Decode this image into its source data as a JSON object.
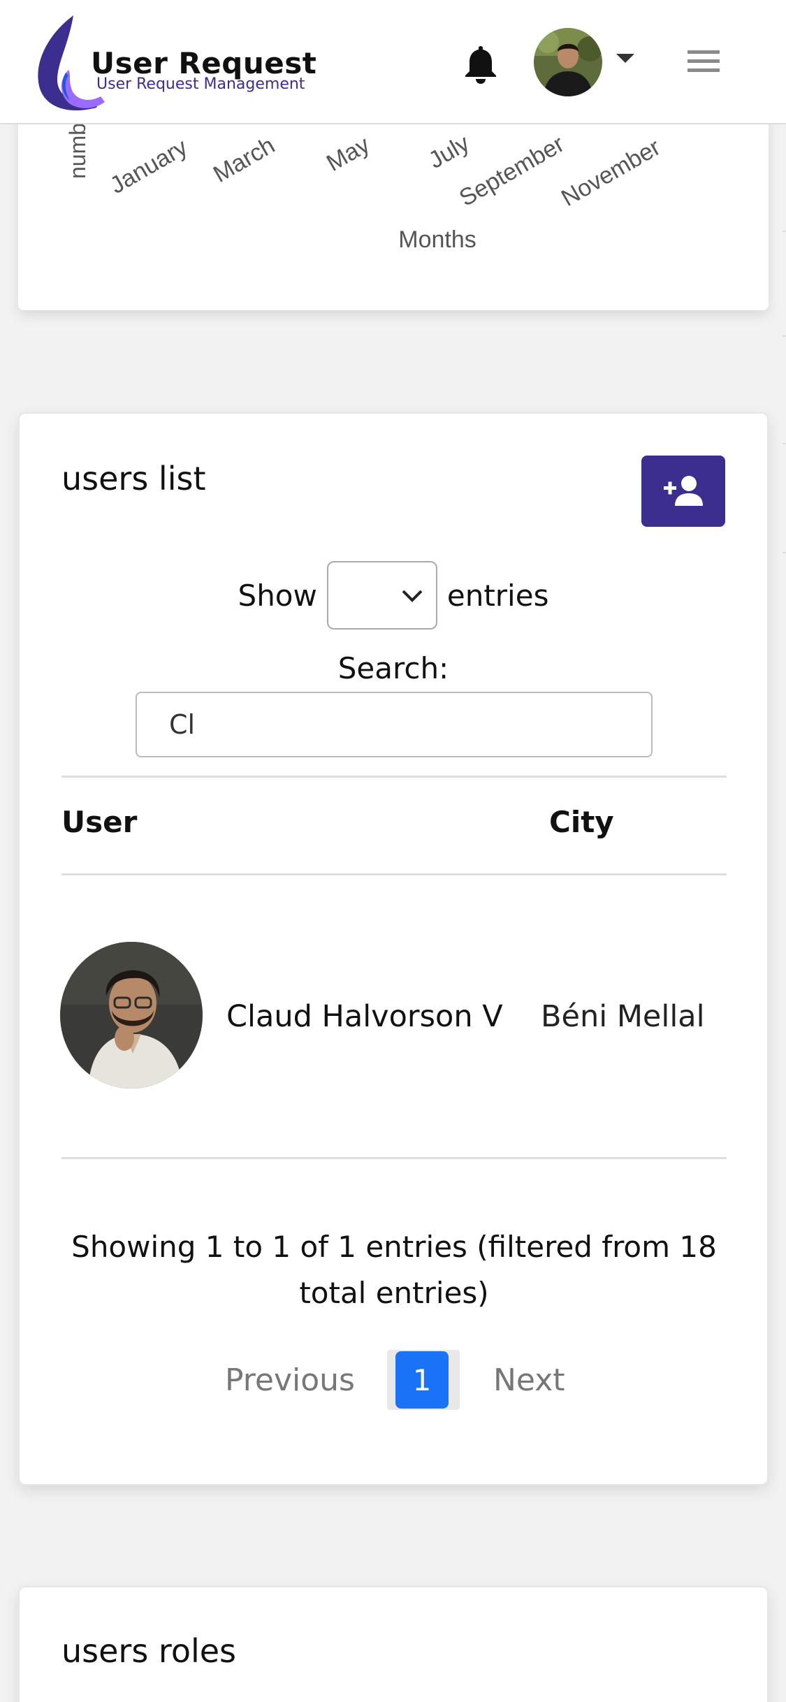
{
  "colors": {
    "brand": "#3b2e8e",
    "accent_blue": "#1a73f6",
    "page_bg": "#f2f2f2"
  },
  "header": {
    "brand_title": "User Request",
    "brand_subtitle": "User Request Management",
    "icons": [
      "logo-icon",
      "bell-icon",
      "caret-down-icon",
      "menu-icon"
    ]
  },
  "chart": {
    "y_label_fragment": "numb",
    "months": [
      "January",
      "March",
      "May",
      "July",
      "September",
      "November"
    ],
    "x_title": "Months"
  },
  "users_list": {
    "title": "users list",
    "show_label": "Show",
    "entries_label": "entries",
    "length_select_value": "",
    "search_label": "Search:",
    "search_value": "Cl",
    "columns": [
      "User",
      "City"
    ],
    "rows": [
      {
        "name": "Claud Halvorson V",
        "city": "Béni Mellal"
      }
    ],
    "info": "Showing 1 to 1 of 1 entries (filtered from 18 total entries)",
    "pagination": {
      "previous": "Previous",
      "current": "1",
      "next": "Next"
    }
  },
  "users_roles": {
    "title": "users roles"
  }
}
